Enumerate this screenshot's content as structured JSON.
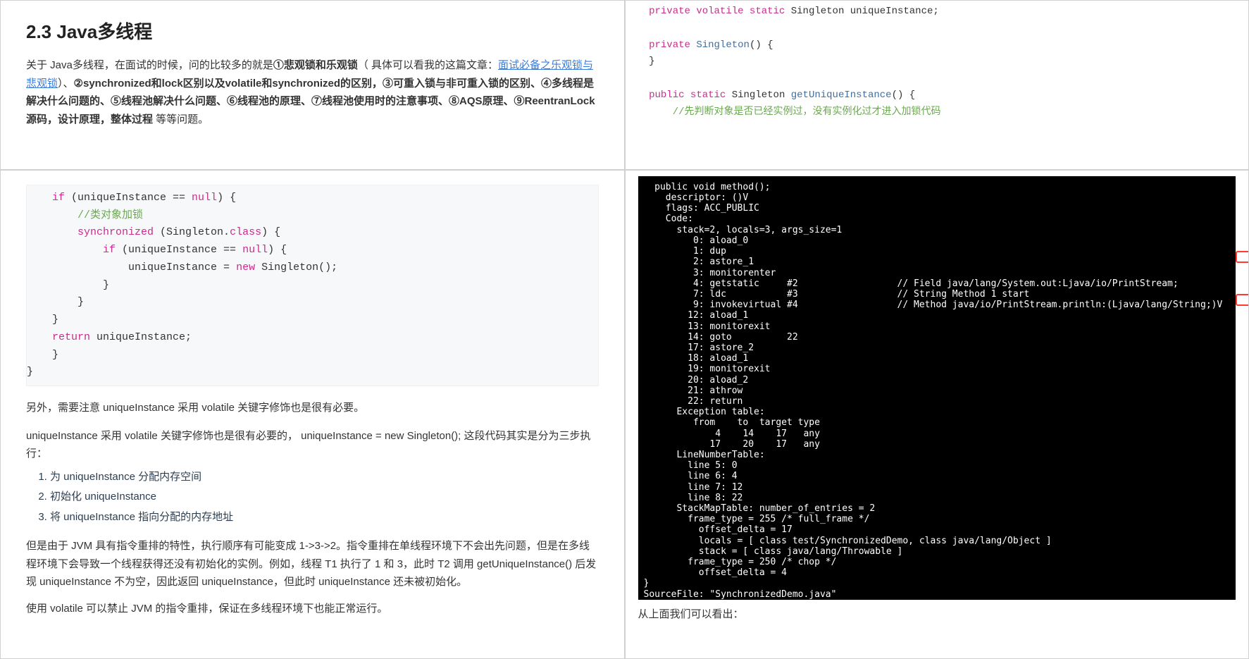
{
  "topLeft": {
    "heading": "2.3 Java多线程",
    "p1_pre": "关于 Java多线程，在面试的时候，问的比较多的就是",
    "p1_b1": "①悲观锁和乐观锁",
    "p1_mid1": "（ 具体可以看我的这篇文章：",
    "p1_link": "面试必备之乐观锁与悲观锁",
    "p1_mid2": "）、",
    "p1_b2": "②synchronized和lock区别以及volatile和synchronized的区别，③可重入锁与非可重入锁的区别、④多线程是解决什么问题的、⑤线程池解决什么问题、⑥线程池的原理、⑦线程池使用时的注意事项、⑧AQS原理、⑨ReentranLock 源码，设计原理，整体过程",
    "p1_end": " 等等问题。"
  },
  "topRight": {
    "line1": {
      "a": "    private volatile static",
      "b": " Singleton uniqueInstance;"
    },
    "line2": {
      "a": "    private",
      "b": " Singleton",
      "c": "() {"
    },
    "line3": "    }",
    "line4": {
      "a": "    public static",
      "b": " Singleton ",
      "c": "getUniqueInstance",
      "d": "() {"
    },
    "line5": "        //先判断对象是否已经实例过，没有实例化过才进入加锁代码"
  },
  "bottomLeft": {
    "code": {
      "l1": {
        "a": "    if",
        "b": " (uniqueInstance == ",
        "c": "null",
        "d": ") {"
      },
      "l2": "        //类对象加锁",
      "l3": {
        "a": "        synchronized",
        "b": " (Singleton.",
        "c": "class",
        "d": ") {"
      },
      "l4": {
        "a": "            if",
        "b": " (uniqueInstance == ",
        "c": "null",
        "d": ") {"
      },
      "l5": {
        "a": "                uniqueInstance = ",
        "b": "new",
        "c": " Singleton();"
      },
      "l6": "            }",
      "l7": "        }",
      "l8": "    }",
      "l9": {
        "a": "    return",
        "b": " uniqueInstance;"
      },
      "l10": "    }",
      "l11": "}"
    },
    "p2": "另外，需要注意 uniqueInstance 采用 volatile 关键字修饰也是很有必要。",
    "p3": "uniqueInstance 采用 volatile 关键字修饰也是很有必要的，  uniqueInstance = new Singleton(); 这段代码其实是分为三步执行：",
    "li1": "为 uniqueInstance 分配内存空间",
    "li2": "初始化 uniqueInstance",
    "li3": "将 uniqueInstance 指向分配的内存地址",
    "p4": "但是由于 JVM 具有指令重排的特性，执行顺序有可能变成 1->3->2。指令重排在单线程环境下不会出先问题，但是在多线程环境下会导致一个线程获得还没有初始化的实例。例如，线程 T1 执行了 1 和 3，此时 T2 调用 getUniqueInstance() 后发现 uniqueInstance 不为空，因此返回 uniqueInstance，但此时 uniqueInstance 还未被初始化。",
    "p5": "使用 volatile 可以禁止 JVM 的指令重排，保证在多线程环境下也能正常运行。"
  },
  "bottomRight": {
    "term": "  public void method();\n    descriptor: ()V\n    flags: ACC_PUBLIC\n    Code:\n      stack=2, locals=3, args_size=1\n         0: aload_0\n         1: dup\n         2: astore_1\n         3: monitorenter\n         4: getstatic     #2                  // Field java/lang/System.out:Ljava/io/PrintStream;\n         7: ldc           #3                  // String Method 1 start\n         9: invokevirtual #4                  // Method java/io/PrintStream.println:(Ljava/lang/String;)V\n        12: aload_1\n        13: monitorexit\n        14: goto          22\n        17: astore_2\n        18: aload_1\n        19: monitorexit\n        20: aload_2\n        21: athrow\n        22: return\n      Exception table:\n         from    to  target type\n             4    14    17   any\n            17    20    17   any\n      LineNumberTable:\n        line 5: 0\n        line 6: 4\n        line 7: 12\n        line 8: 22\n      StackMapTable: number_of_entries = 2\n        frame_type = 255 /* full_frame */\n          offset_delta = 17\n          locals = [ class test/SynchronizedDemo, class java/lang/Object ]\n          stack = [ class java/lang/Throwable ]\n        frame_type = 250 /* chop */\n          offset_delta = 4\n}\nSourceFile: \"SynchronizedDemo.java\"",
    "caption": "从上面我们可以看出："
  }
}
